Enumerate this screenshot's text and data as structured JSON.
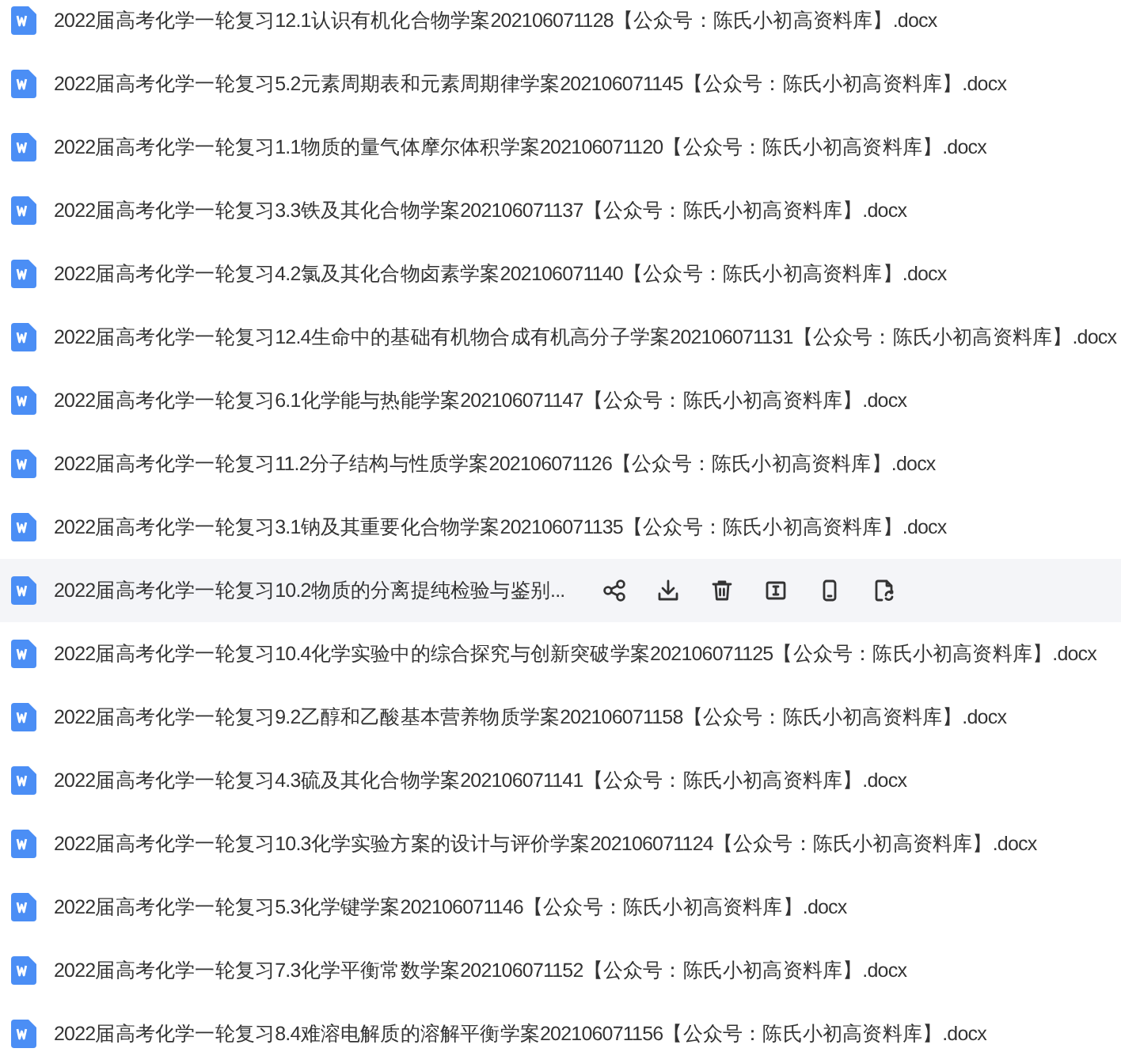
{
  "files": [
    {
      "name": "2022届高考化学一轮复习12.1认识有机化合物学案202106071128【公众号：陈氏小初高资料库】.docx",
      "hovered": false
    },
    {
      "name": "2022届高考化学一轮复习5.2元素周期表和元素周期律学案202106071145【公众号：陈氏小初高资料库】.docx",
      "hovered": false
    },
    {
      "name": "2022届高考化学一轮复习1.1物质的量气体摩尔体积学案202106071120【公众号：陈氏小初高资料库】.docx",
      "hovered": false
    },
    {
      "name": "2022届高考化学一轮复习3.3铁及其化合物学案202106071137【公众号：陈氏小初高资料库】.docx",
      "hovered": false
    },
    {
      "name": "2022届高考化学一轮复习4.2氯及其化合物卤素学案202106071140【公众号：陈氏小初高资料库】.docx",
      "hovered": false
    },
    {
      "name": "2022届高考化学一轮复习12.4生命中的基础有机物合成有机高分子学案202106071131【公众号：陈氏小初高资料库】.docx",
      "hovered": false
    },
    {
      "name": "2022届高考化学一轮复习6.1化学能与热能学案202106071147【公众号：陈氏小初高资料库】.docx",
      "hovered": false
    },
    {
      "name": "2022届高考化学一轮复习11.2分子结构与性质学案202106071126【公众号：陈氏小初高资料库】.docx",
      "hovered": false
    },
    {
      "name": "2022届高考化学一轮复习3.1钠及其重要化合物学案202106071135【公众号：陈氏小初高资料库】.docx",
      "hovered": false
    },
    {
      "name": "2022届高考化学一轮复习10.2物质的分离提纯检验与鉴别...",
      "hovered": true
    },
    {
      "name": "2022届高考化学一轮复习10.4化学实验中的综合探究与创新突破学案202106071125【公众号：陈氏小初高资料库】.docx",
      "hovered": false
    },
    {
      "name": "2022届高考化学一轮复习9.2乙醇和乙酸基本营养物质学案202106071158【公众号：陈氏小初高资料库】.docx",
      "hovered": false
    },
    {
      "name": "2022届高考化学一轮复习4.3硫及其化合物学案202106071141【公众号：陈氏小初高资料库】.docx",
      "hovered": false
    },
    {
      "name": "2022届高考化学一轮复习10.3化学实验方案的设计与评价学案202106071124【公众号：陈氏小初高资料库】.docx",
      "hovered": false
    },
    {
      "name": "2022届高考化学一轮复习5.3化学键学案202106071146【公众号：陈氏小初高资料库】.docx",
      "hovered": false
    },
    {
      "name": "2022届高考化学一轮复习7.3化学平衡常数学案202106071152【公众号：陈氏小初高资料库】.docx",
      "hovered": false
    },
    {
      "name": "2022届高考化学一轮复习8.4难溶电解质的溶解平衡学案202106071156【公众号：陈氏小初高资料库】.docx",
      "hovered": false
    }
  ]
}
